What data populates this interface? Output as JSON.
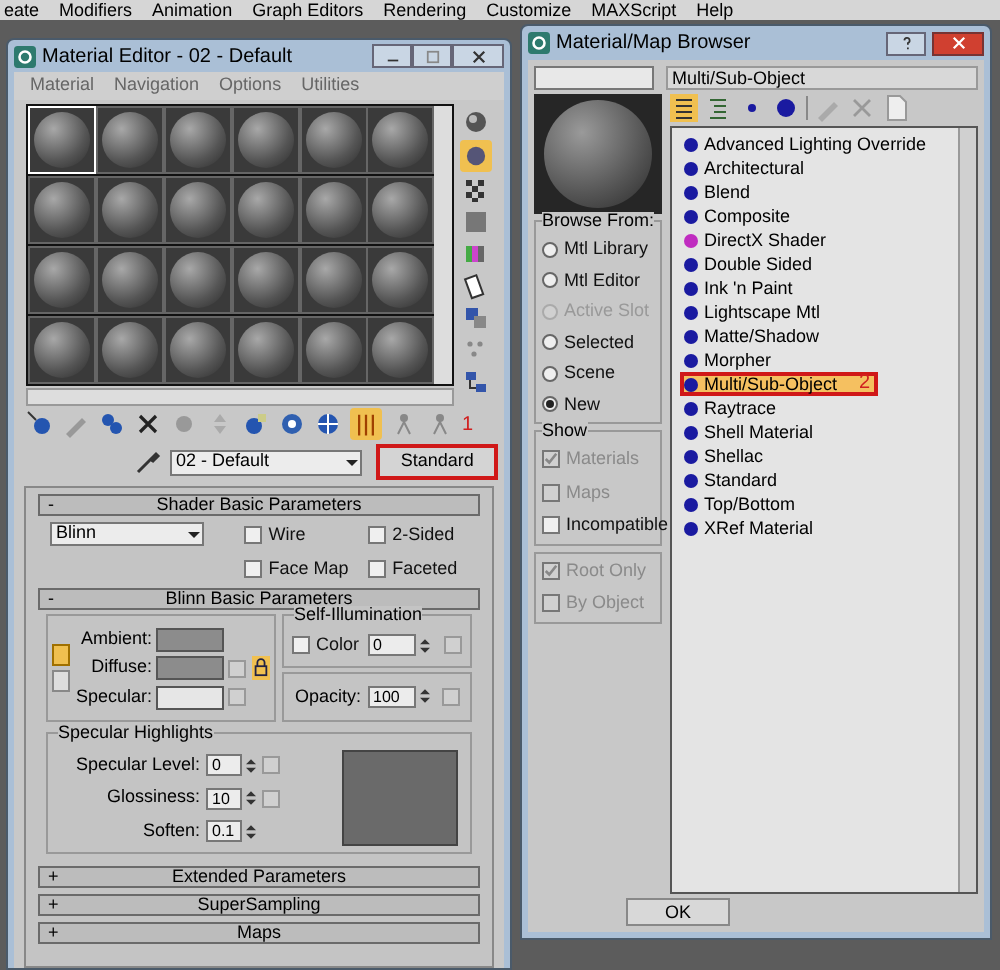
{
  "app_menu": [
    "eate",
    "Modifiers",
    "Animation",
    "Graph Editors",
    "Rendering",
    "Customize",
    "MAXScript",
    "Help"
  ],
  "material_editor": {
    "title": "Material Editor - 02 - Default",
    "menu": [
      "Material",
      "Navigation",
      "Options",
      "Utilities"
    ],
    "slots": [
      {
        "selected": true
      },
      {
        "selected": false
      },
      {
        "selected": false
      },
      {
        "selected": false
      },
      {
        "selected": false
      },
      {
        "selected": false
      },
      {
        "selected": false
      },
      {
        "selected": false
      },
      {
        "selected": false
      },
      {
        "selected": false
      },
      {
        "selected": false
      },
      {
        "selected": false
      },
      {
        "selected": false
      },
      {
        "selected": false
      },
      {
        "selected": false
      },
      {
        "selected": false
      },
      {
        "selected": false
      },
      {
        "selected": false
      },
      {
        "selected": false
      },
      {
        "selected": false
      },
      {
        "selected": false
      },
      {
        "selected": false
      },
      {
        "selected": false
      },
      {
        "selected": false
      }
    ],
    "annotation": "1",
    "material_name": "02 - Default",
    "type_button": {
      "label": "Standard",
      "highlighted": true
    },
    "shader_rollout": {
      "sign": "-",
      "title": "Shader Basic Parameters",
      "shader": "Blinn",
      "checkboxes": [
        {
          "label": "Wire",
          "checked": false
        },
        {
          "label": "2-Sided",
          "checked": false
        },
        {
          "label": "Face Map",
          "checked": false
        },
        {
          "label": "Faceted",
          "checked": false
        }
      ]
    },
    "blinn_rollout": {
      "sign": "-",
      "title": "Blinn Basic Parameters",
      "colors": [
        {
          "label": "Ambient:",
          "color": "#8c8c8c"
        },
        {
          "label": "Diffuse:",
          "color": "#8c8c8c"
        },
        {
          "label": "Specular:",
          "color": "#e6e6e6"
        }
      ],
      "self_illumination": {
        "title": "Self-Illumination",
        "checkbox": {
          "label": "Color",
          "checked": false
        },
        "value": "0"
      },
      "opacity": {
        "label": "Opacity:",
        "value": "100"
      },
      "specular_highlights": {
        "title": "Specular Highlights",
        "fields": [
          {
            "label": "Specular Level:",
            "value": "0"
          },
          {
            "label": "Glossiness:",
            "value": "10"
          },
          {
            "label": "Soften:",
            "value": "0.1"
          }
        ]
      }
    },
    "collapsed_rollouts": [
      {
        "sign": "+",
        "title": "Extended Parameters"
      },
      {
        "sign": "+",
        "title": "SuperSampling"
      },
      {
        "sign": "+",
        "title": "Maps"
      }
    ]
  },
  "browser": {
    "title": "Material/Map Browser",
    "current": "Multi/Sub-Object",
    "browse_from": {
      "title": "Browse From:",
      "options": [
        {
          "label": "Mtl Library",
          "selected": false,
          "disabled": false
        },
        {
          "label": "Mtl Editor",
          "selected": false,
          "disabled": false
        },
        {
          "label": "Active Slot",
          "selected": false,
          "disabled": true
        },
        {
          "label": "Selected",
          "selected": false,
          "disabled": false
        },
        {
          "label": "Scene",
          "selected": false,
          "disabled": false
        },
        {
          "label": "New",
          "selected": true,
          "disabled": false
        }
      ]
    },
    "show": {
      "title": "Show",
      "options": [
        {
          "label": "Materials",
          "checked": true,
          "disabled": true
        },
        {
          "label": "Maps",
          "checked": false,
          "disabled": true
        },
        {
          "label": "Incompatible",
          "checked": false,
          "disabled": false
        }
      ]
    },
    "root_options": [
      {
        "label": "Root Only",
        "checked": true,
        "disabled": true
      },
      {
        "label": "By Object",
        "checked": false,
        "disabled": true
      }
    ],
    "items": [
      {
        "label": "Advanced Lighting Override",
        "color": "#1a1aa0",
        "selected": false
      },
      {
        "label": "Architectural",
        "color": "#1a1aa0",
        "selected": false
      },
      {
        "label": "Blend",
        "color": "#1a1aa0",
        "selected": false
      },
      {
        "label": "Composite",
        "color": "#1a1aa0",
        "selected": false
      },
      {
        "label": "DirectX Shader",
        "color": "#c02cc0",
        "selected": false
      },
      {
        "label": "Double Sided",
        "color": "#1a1aa0",
        "selected": false
      },
      {
        "label": "Ink 'n Paint",
        "color": "#1a1aa0",
        "selected": false
      },
      {
        "label": "Lightscape Mtl",
        "color": "#1a1aa0",
        "selected": false
      },
      {
        "label": "Matte/Shadow",
        "color": "#1a1aa0",
        "selected": false
      },
      {
        "label": "Morpher",
        "color": "#1a1aa0",
        "selected": false
      },
      {
        "label": "Multi/Sub-Object",
        "color": "#1a1aa0",
        "selected": true
      },
      {
        "label": "Raytrace",
        "color": "#1a1aa0",
        "selected": false
      },
      {
        "label": "Shell Material",
        "color": "#1a1aa0",
        "selected": false
      },
      {
        "label": "Shellac",
        "color": "#1a1aa0",
        "selected": false
      },
      {
        "label": "Standard",
        "color": "#1a1aa0",
        "selected": false
      },
      {
        "label": "Top/Bottom",
        "color": "#1a1aa0",
        "selected": false
      },
      {
        "label": "XRef Material",
        "color": "#1a1aa0",
        "selected": false
      }
    ],
    "annotation": "2",
    "ok": "OK"
  }
}
